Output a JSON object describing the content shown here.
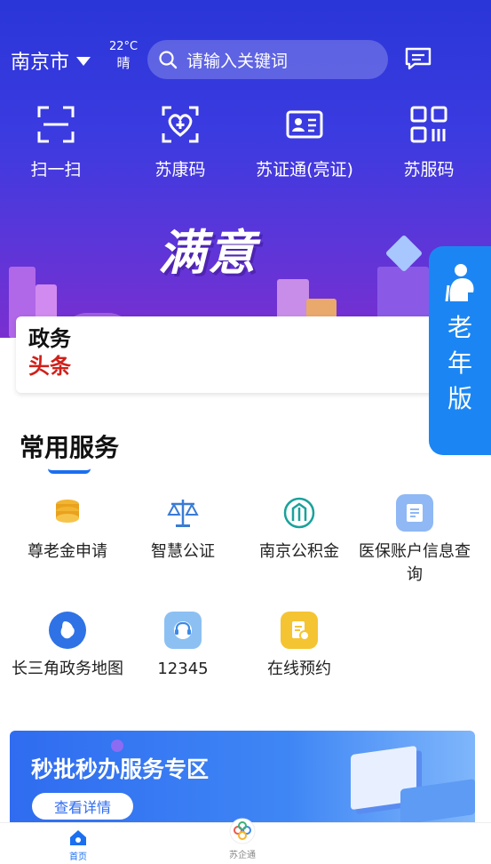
{
  "header": {
    "city": "南京市",
    "temperature": "22°C",
    "weather": "晴",
    "search_placeholder": "请输入关键词"
  },
  "quick_actions": [
    {
      "label": "扫一扫",
      "icon": "scan-icon"
    },
    {
      "label": "苏康码",
      "icon": "health-code-icon"
    },
    {
      "label": "苏证通(亮证)",
      "icon": "id-card-icon"
    },
    {
      "label": "苏服码",
      "icon": "service-code-icon"
    }
  ],
  "banner": {
    "slogan": "满意"
  },
  "gov_news": {
    "line1": "政务",
    "line2": "头条"
  },
  "elder_mode": {
    "label": "老年版"
  },
  "common_services": {
    "title": "常用服务",
    "items": [
      {
        "label": "尊老金申请",
        "icon": "coins-icon"
      },
      {
        "label": "智慧公证",
        "icon": "scales-icon"
      },
      {
        "label": "南京公积金",
        "icon": "housing-fund-icon"
      },
      {
        "label": "医保账户信息查询",
        "icon": "medical-insurance-icon"
      },
      {
        "label": "长三角政务地图",
        "icon": "map-icon"
      },
      {
        "label": "12345",
        "icon": "hotline-icon"
      },
      {
        "label": "在线预约",
        "icon": "appointment-icon"
      }
    ]
  },
  "promo": {
    "title": "秒批秒办服务专区",
    "button": "查看详情"
  },
  "tabbar": [
    {
      "label": "首页",
      "icon": "home-icon",
      "active": true
    },
    {
      "label": "苏企通",
      "icon": "enterprise-icon",
      "active": false
    }
  ],
  "colors": {
    "primary": "#1b6ff0",
    "headline_red": "#d0201a",
    "elder_blue": "#1b86f3"
  }
}
